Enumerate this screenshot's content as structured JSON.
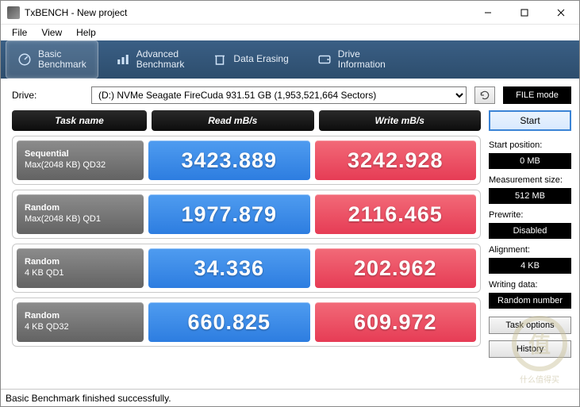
{
  "window": {
    "title": "TxBENCH - New project"
  },
  "menu": {
    "file": "File",
    "view": "View",
    "help": "Help"
  },
  "tabs": {
    "basic": "Basic\nBenchmark",
    "advanced": "Advanced\nBenchmark",
    "erase": "Data Erasing",
    "drive": "Drive\nInformation"
  },
  "drive": {
    "label": "Drive:",
    "selected": "(D:) NVMe Seagate FireCuda  931.51 GB (1,953,521,664 Sectors)",
    "filemode": "FILE mode"
  },
  "headers": {
    "task": "Task name",
    "read": "Read mB/s",
    "write": "Write mB/s"
  },
  "rows": [
    {
      "line1": "Sequential",
      "line2": "Max(2048 KB) QD32",
      "read": "3423.889",
      "write": "3242.928"
    },
    {
      "line1": "Random",
      "line2": "Max(2048 KB) QD1",
      "read": "1977.879",
      "write": "2116.465"
    },
    {
      "line1": "Random",
      "line2": "4 KB QD1",
      "read": "34.336",
      "write": "202.962"
    },
    {
      "line1": "Random",
      "line2": "4 KB QD32",
      "read": "660.825",
      "write": "609.972"
    }
  ],
  "side": {
    "start": "Start",
    "startpos_lbl": "Start position:",
    "startpos_val": "0 MB",
    "meas_lbl": "Measurement size:",
    "meas_val": "512 MB",
    "prewrite_lbl": "Prewrite:",
    "prewrite_val": "Disabled",
    "align_lbl": "Alignment:",
    "align_val": "4 KB",
    "data_lbl": "Writing data:",
    "data_val": "Random number",
    "taskopt": "Task options",
    "history": "History"
  },
  "status": "Basic Benchmark finished successfully.",
  "chart_data": {
    "type": "table",
    "title": "TxBENCH Basic Benchmark",
    "columns": [
      "Task",
      "Read mB/s",
      "Write mB/s"
    ],
    "rows": [
      [
        "Sequential Max(2048 KB) QD32",
        3423.889,
        3242.928
      ],
      [
        "Random Max(2048 KB) QD1",
        1977.879,
        2116.465
      ],
      [
        "Random 4 KB QD1",
        34.336,
        202.962
      ],
      [
        "Random 4 KB QD32",
        660.825,
        609.972
      ]
    ]
  }
}
